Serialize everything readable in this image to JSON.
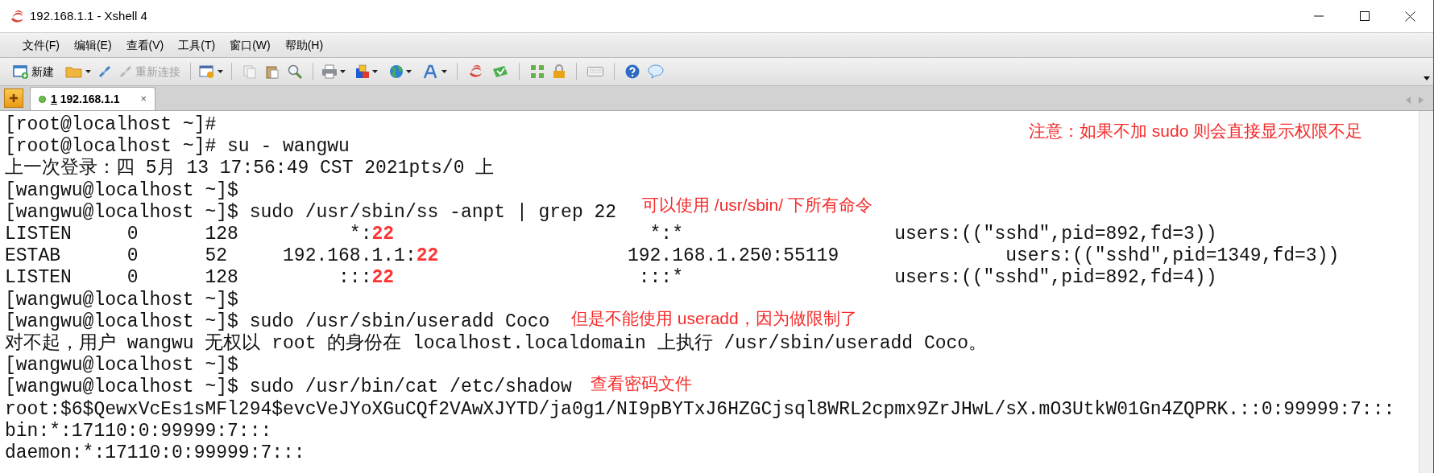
{
  "window": {
    "title": "192.168.1.1 - Xshell 4"
  },
  "menu": [
    "文件(F)",
    "编辑(E)",
    "查看(V)",
    "工具(T)",
    "窗口(W)",
    "帮助(H)"
  ],
  "toolbar": {
    "buttons": [
      {
        "label": "新建",
        "disabled": false
      },
      {
        "label": "重新连接",
        "disabled": true
      }
    ]
  },
  "tabs": [
    {
      "number": "1",
      "label": "192.168.1.1",
      "selected": true,
      "connected": true,
      "close": "×"
    }
  ],
  "terminal": {
    "lines": [
      {
        "text": "[root@localhost ~]#"
      },
      {
        "text": "[root@localhost ~]# su - wangwu"
      },
      {
        "text": "上一次登录：四 5月 13 17:56:49 CST 2021pts/0 上"
      },
      {
        "text": "[wangwu@localhost ~]$"
      },
      {
        "text": "[wangwu@localhost ~]$ sudo /usr/sbin/ss -anpt | grep 22"
      },
      {
        "segments": [
          {
            "text": "LISTEN     0      128          *:",
            "highlight": false
          },
          {
            "text": "22",
            "highlight": true
          },
          {
            "text": "                       *:*                   users:((\"sshd\",pid=892,fd=3))",
            "highlight": false
          }
        ]
      },
      {
        "segments": [
          {
            "text": "ESTAB      0      52     192.168.1.1:",
            "highlight": false
          },
          {
            "text": "22",
            "highlight": true
          },
          {
            "text": "                 192.168.1.250:55119               users:((\"sshd\",pid=1349,fd=3))",
            "highlight": false
          }
        ]
      },
      {
        "segments": [
          {
            "text": "LISTEN     0      128         :::",
            "highlight": false
          },
          {
            "text": "22",
            "highlight": true
          },
          {
            "text": "                      :::*                   users:((\"sshd\",pid=892,fd=4))",
            "highlight": false
          }
        ]
      },
      {
        "text": "[wangwu@localhost ~]$"
      },
      {
        "text": "[wangwu@localhost ~]$ sudo /usr/sbin/useradd Coco"
      },
      {
        "text": "对不起，用户 wangwu 无权以 root 的身份在 localhost.localdomain 上执行 /usr/sbin/useradd Coco。"
      },
      {
        "text": "[wangwu@localhost ~]$"
      },
      {
        "text": "[wangwu@localhost ~]$ sudo /usr/bin/cat /etc/shadow"
      },
      {
        "text": "root:$6$QewxVcEs1sMFl294$evcVeJYoXGuCQf2VAwXJYTD/ja0g1/NI9pBYTxJ6HZGCjsql8WRL2cpmx9ZrJHwL/sX.mO3UtkW01Gn4ZQPRK.::0:99999:7:::"
      },
      {
        "text": "bin:*:17110:0:99999:7:::"
      },
      {
        "text": "daemon:*:17110:0:99999:7:::"
      }
    ]
  },
  "annotations": [
    {
      "text": "注意：如果不加 sudo 则会直接显示权限不足"
    },
    {
      "text": "可以使用 /usr/sbin/ 下所有命令"
    },
    {
      "text": "但是不能使用 useradd，因为做限制了"
    },
    {
      "text": "查看密码文件"
    }
  ]
}
